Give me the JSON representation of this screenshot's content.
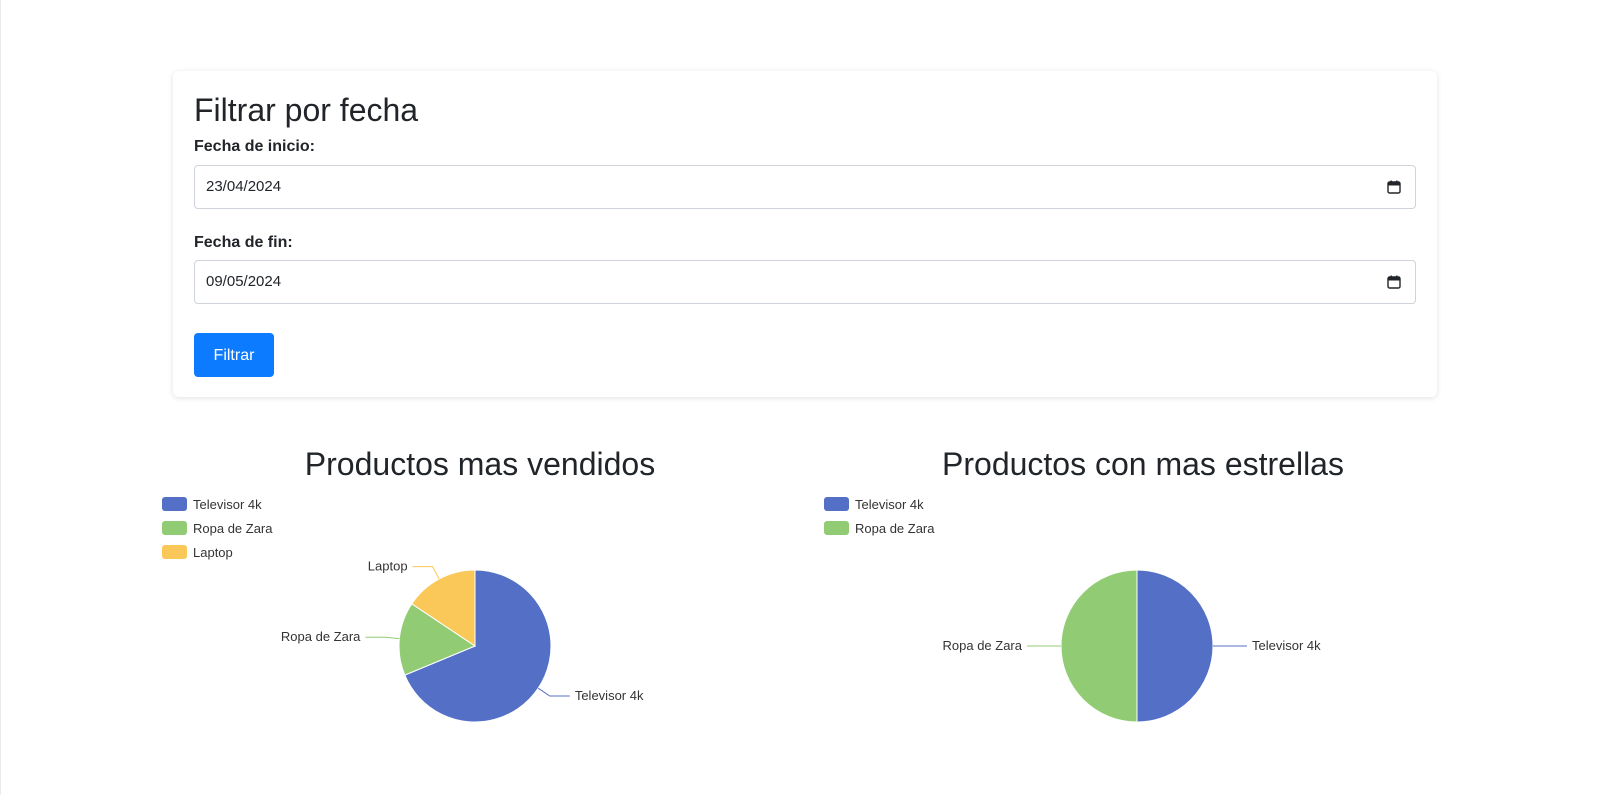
{
  "filter": {
    "title": "Filtrar por fecha",
    "start_label": "Fecha de inicio:",
    "start_value": "23/04/2024",
    "end_label": "Fecha de fin:",
    "end_value": "09/05/2024",
    "button_label": "Filtrar",
    "button_color": "#0d7bff"
  },
  "chart_data": [
    {
      "type": "pie",
      "title": "Productos mas vendidos",
      "categories": [
        "Televisor 4k",
        "Ropa de Zara",
        "Laptop"
      ],
      "values": [
        68.75,
        15.63,
        15.63
      ],
      "colors": [
        "#5470c6",
        "#91cc75",
        "#fac858"
      ],
      "legend_position": "top-left"
    },
    {
      "type": "pie",
      "title": "Productos con mas estrellas",
      "categories": [
        "Televisor 4k",
        "Ropa de Zara"
      ],
      "values": [
        50,
        50
      ],
      "colors": [
        "#5470c6",
        "#91cc75"
      ],
      "legend_position": "top-left"
    }
  ]
}
